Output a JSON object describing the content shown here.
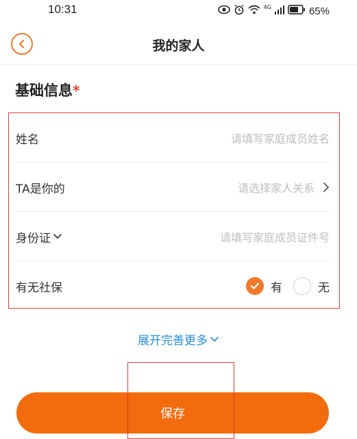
{
  "status_bar": {
    "time": "10:31",
    "network": "4G",
    "battery": "65%"
  },
  "header": {
    "title": "我的家人"
  },
  "section": {
    "title": "基础信息",
    "required_mark": "*"
  },
  "form": {
    "name": {
      "label": "姓名",
      "placeholder": "请填写家庭成员姓名"
    },
    "relation": {
      "label": "TA是你的",
      "placeholder": "请选择家人关系"
    },
    "id_card": {
      "label": "身份证",
      "placeholder": "请填写家庭成员证件号"
    },
    "social_security": {
      "label": "有无社保",
      "option_yes": "有",
      "option_no": "无",
      "selected": "有"
    }
  },
  "expand_more": {
    "label": "展开完善更多"
  },
  "save_button": {
    "label": "保存"
  },
  "colors": {
    "accent": "#f26b0d",
    "link": "#2a8ed8",
    "highlight": "#e23a3a"
  }
}
